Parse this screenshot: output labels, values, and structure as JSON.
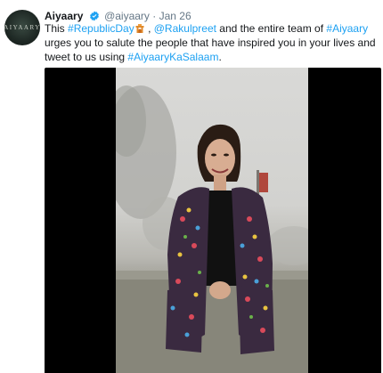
{
  "tweet": {
    "display_name": "Aiyaary",
    "handle": "@aiyaary",
    "separator": "·",
    "date": "Jan 26",
    "avatar_text": "AIYAARY",
    "text_parts": {
      "t1": "This ",
      "hashtag1": "#RepublicDay",
      "t2": " , ",
      "mention1": "@Rakulpreet",
      "t3": "  and the entire team of ",
      "hashtag2": "#Aiyaary",
      "t4": " urges you to salute the people that have inspired you in your lives and tweet to us using ",
      "hashtag3": "#AiyaaryKaSalaam",
      "t5": "."
    },
    "emoji_name": "flag-gate-icon"
  },
  "media": {
    "type": "video",
    "description_icon": "video-frame"
  },
  "colors": {
    "link": "#1da1f2",
    "verified": "#1da1f2",
    "muted": "#657786",
    "media_bg": "#000000"
  }
}
